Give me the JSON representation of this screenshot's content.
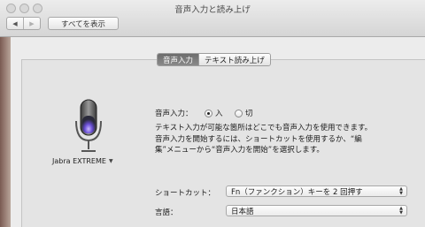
{
  "window": {
    "title": "音声入力と読み上げ"
  },
  "toolbar": {
    "back_icon": "chevron-left-icon",
    "forward_icon": "chevron-right-icon",
    "show_all_label": "すべてを表示"
  },
  "tabs": [
    {
      "label": "音声入力",
      "active": true
    },
    {
      "label": "テキスト読み上げ",
      "active": false
    }
  ],
  "microphone": {
    "device_name": "Jabra EXTREME"
  },
  "dictation": {
    "label": "音声入力：",
    "options": [
      {
        "label": "入",
        "selected": true
      },
      {
        "label": "切",
        "selected": false
      }
    ],
    "description_lines": [
      "テキスト入力が可能な箇所はどこでも音声入力を使用できます。",
      "音声入力を開始するには、ショートカットを使用するか、“編",
      "集”メニューから“音声入力を開始”を選択します。"
    ]
  },
  "shortcut": {
    "label": "ショートカット：",
    "value": "Fn（ファンクション）キーを 2 回押す"
  },
  "language": {
    "label": "言語：",
    "value": "日本語"
  },
  "colors": {
    "active_tab": "#7a7a7a",
    "mic_glow": "#6a4fd6"
  }
}
